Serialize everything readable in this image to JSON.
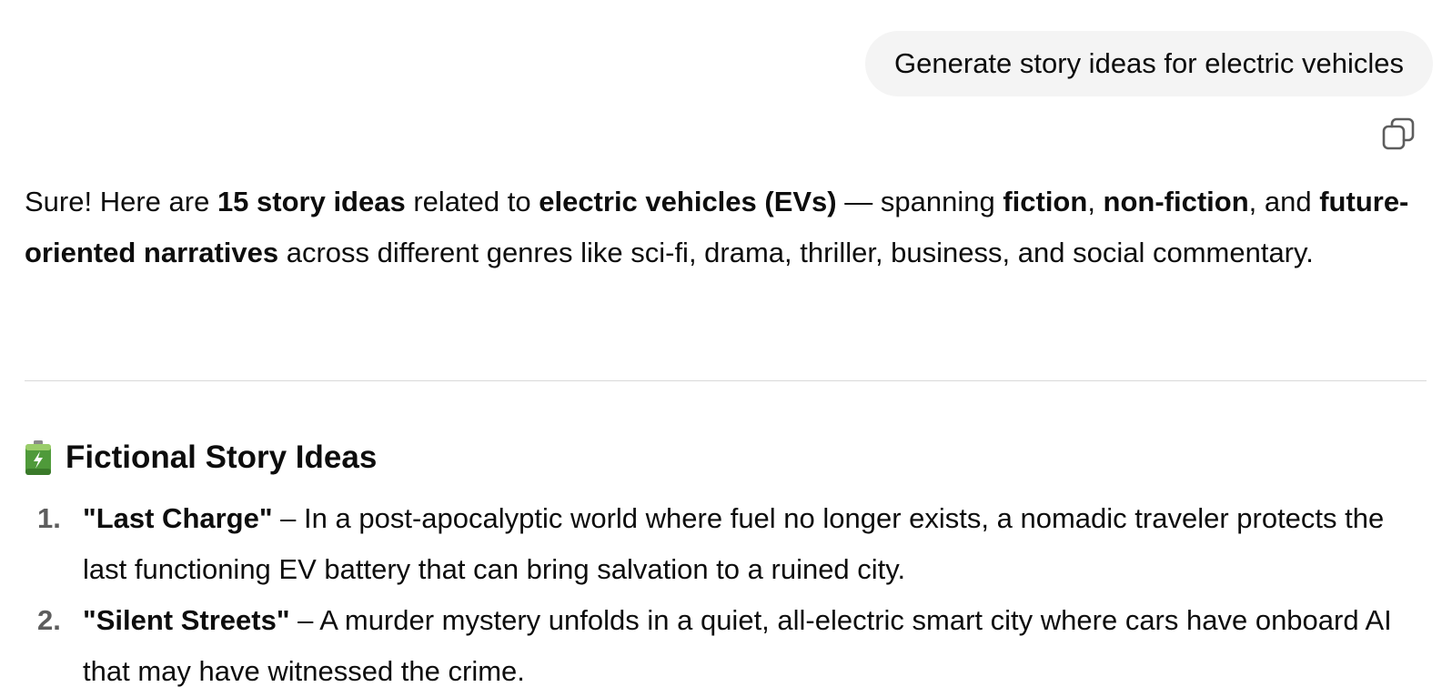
{
  "conversation": {
    "user_message": "Generate story ideas for electric vehicles",
    "copy_button": {
      "icon": "copy-icon"
    },
    "response": {
      "intro": {
        "t1": "Sure! Here are ",
        "b1": "15 story ideas",
        "t2": " related to ",
        "b2": "electric vehicles (EVs)",
        "t3": " — spanning ",
        "b3": "fiction",
        "t4": ", ",
        "b4": "non-fiction",
        "t5": ", and ",
        "b5": "future-oriented narratives",
        "t6": " across different genres like sci-fi, drama, thriller, business, and social commentary."
      },
      "section": {
        "icon": "battery-icon",
        "heading": "Fictional Story Ideas",
        "items": [
          {
            "number": "1.",
            "title": "\"Last Charge\"",
            "text": " – In a post-apocalyptic world where fuel no longer exists, a nomadic traveler protects the last functioning EV battery that can bring salvation to a ruined city."
          },
          {
            "number": "2.",
            "title": "\"Silent Streets\"",
            "text": " – A murder mystery unfolds in a quiet, all-electric smart city where cars have onboard AI that may have witnessed the crime."
          }
        ]
      }
    }
  }
}
